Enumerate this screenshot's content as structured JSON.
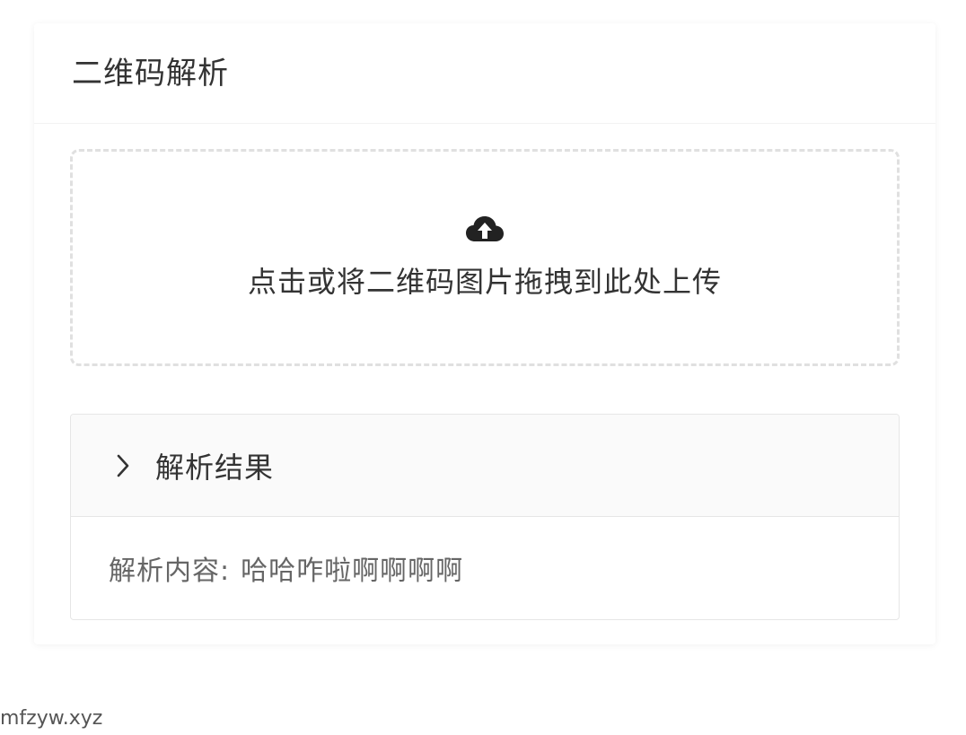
{
  "card": {
    "title": "二维码解析"
  },
  "upload": {
    "icon": "cloud-upload-icon",
    "text": "点击或将二维码图片拖拽到此处上传"
  },
  "result": {
    "panel_title": "解析结果",
    "chevron_icon": "chevron-right-icon",
    "content_label": "解析内容:",
    "content_value": "哈哈咋啦啊啊啊啊"
  },
  "watermark": "mfzyw.xyz",
  "colors": {
    "text_primary": "#333333",
    "text_secondary": "#666666",
    "dashed_border": "#e0e0e0",
    "panel_header_bg": "#fafafa"
  }
}
